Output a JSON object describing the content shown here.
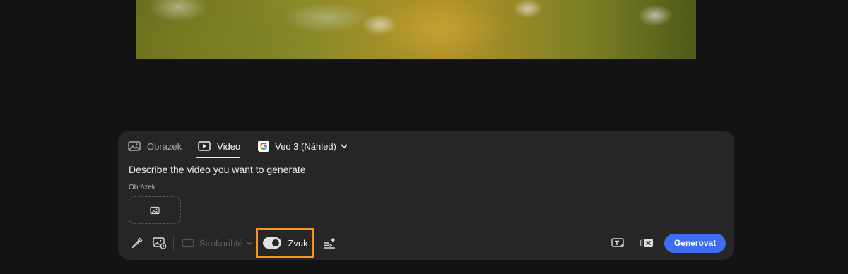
{
  "preview": {
    "icon": "blurred-flower-meadow-photo"
  },
  "tabs": [
    {
      "label": "Obrázek",
      "icon": "image-icon",
      "active": false
    },
    {
      "label": "Video",
      "icon": "video-play-icon",
      "active": true
    }
  ],
  "model": {
    "label": "Veo 3 (Náhled)",
    "icon": "google-logo-icon"
  },
  "prompt": {
    "placeholder": "Describe the video you want to generate"
  },
  "image_upload": {
    "label": "Obrázek",
    "icon": "image-icon"
  },
  "toolbar": {
    "aspect_label": "Širokoúhlé",
    "sound_label": "Zvuk",
    "sound_on": true,
    "generate_label": "Generovat",
    "icons": [
      "eyedropper-icon",
      "image-add-icon",
      "sparkle-motion-icon",
      "text-style-icon",
      "video-settings-icon"
    ]
  },
  "colors": {
    "accent": "#3f6df2",
    "highlight": "#f7931e",
    "panel": "#262626",
    "background": "#131313"
  }
}
